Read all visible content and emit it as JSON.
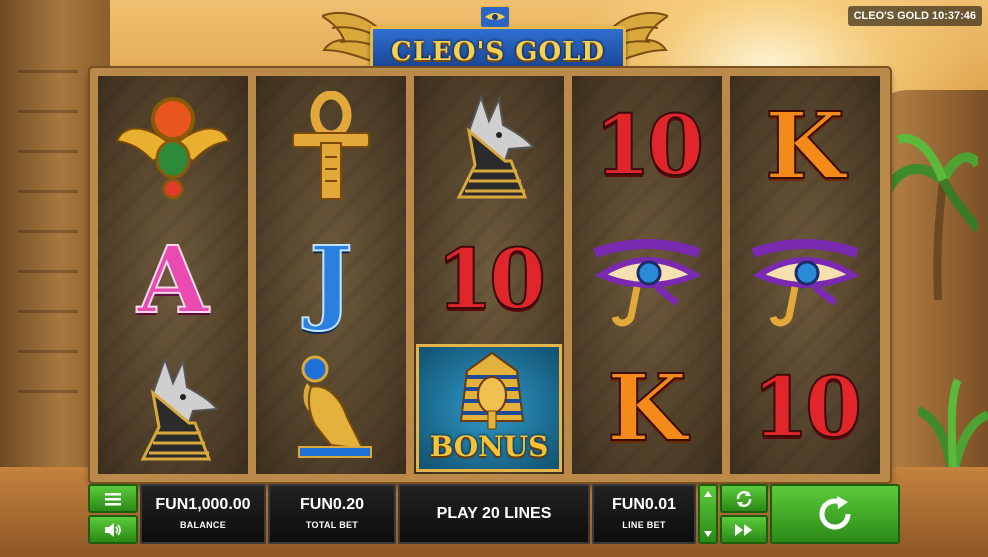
{
  "header": {
    "game_title": "CLEO'S GOLD",
    "clock_label": "CLEO'S GOLD 10:37:46"
  },
  "reels": {
    "columns": [
      [
        "scarab",
        "A",
        "anubis"
      ],
      [
        "ankh",
        "J",
        "falcon"
      ],
      [
        "anubis",
        "10",
        "pharaoh-bonus"
      ],
      [
        "10",
        "eye-of-horus",
        "K"
      ],
      [
        "K",
        "eye-of-horus",
        "10"
      ]
    ],
    "letters": {
      "a": "A",
      "j": "J",
      "k": "K",
      "ten": "10"
    },
    "bonus_label": "BONUS"
  },
  "controls": {
    "balance_value": "FUN1,000.00",
    "balance_label": "BALANCE",
    "total_bet_value": "FUN0.20",
    "total_bet_label": "TOTAL BET",
    "lines_label": "PLAY 20 LINES",
    "line_bet_value": "FUN0.01",
    "line_bet_label": "LINE BET"
  },
  "icons": {
    "menu": "menu-icon",
    "sound": "speaker-icon",
    "autoplay": "autoplay-icon",
    "fast_forward": "fast-forward-icon",
    "spin": "spin-icon",
    "bet_up": "arrow-up-icon",
    "bet_down": "arrow-down-icon"
  },
  "colors": {
    "button_green": "#3aa823",
    "panel_black": "#111111",
    "logo_blue": "#1f4f9e",
    "logo_gold": "#f6d050"
  }
}
